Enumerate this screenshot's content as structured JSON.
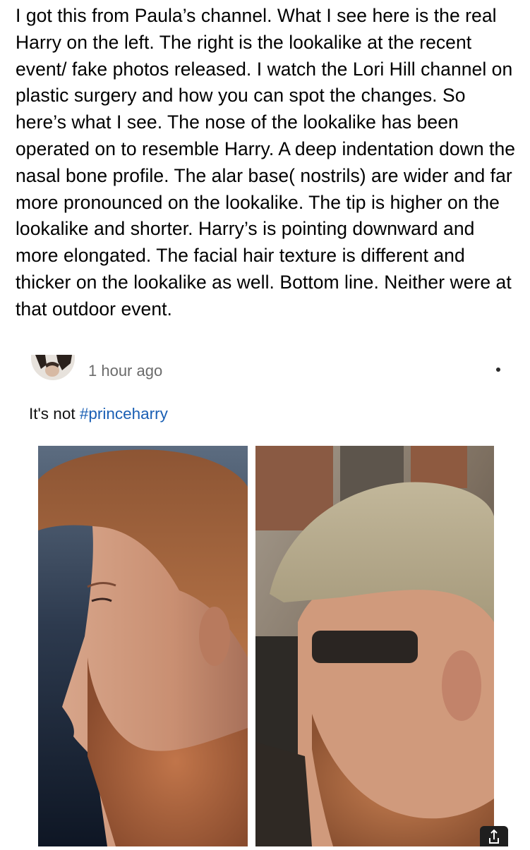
{
  "post": {
    "text": "I got this from Paula’s channel.  What I see here is the real Harry on the left.  The right is the lookalike at the recent event/ fake photos released.  I watch the Lori Hill channel on plastic surgery and how you can spot the changes.  So here’s what I see.  The nose of the lookalike has been operated on to resemble Harry.  A deep indentation down the nasal bone profile.  The alar base( nostrils)  are wider and far more pronounced on the lookalike.  The tip is higher on the lookalike and shorter.  Harry’s is pointing downward and more elongated. The facial hair texture is different and thicker on the lookalike as well.  Bottom line.  Neither were at that outdoor event."
  },
  "comment": {
    "timestamp": "1 hour ago",
    "text_prefix": "It's not ",
    "hashtag": "#princeharry"
  },
  "colors": {
    "hashtag": "#1a5fb4",
    "timestamp": "#6b6b6b"
  },
  "icons": {
    "more": "more-options-icon",
    "corner": "share-icon"
  }
}
